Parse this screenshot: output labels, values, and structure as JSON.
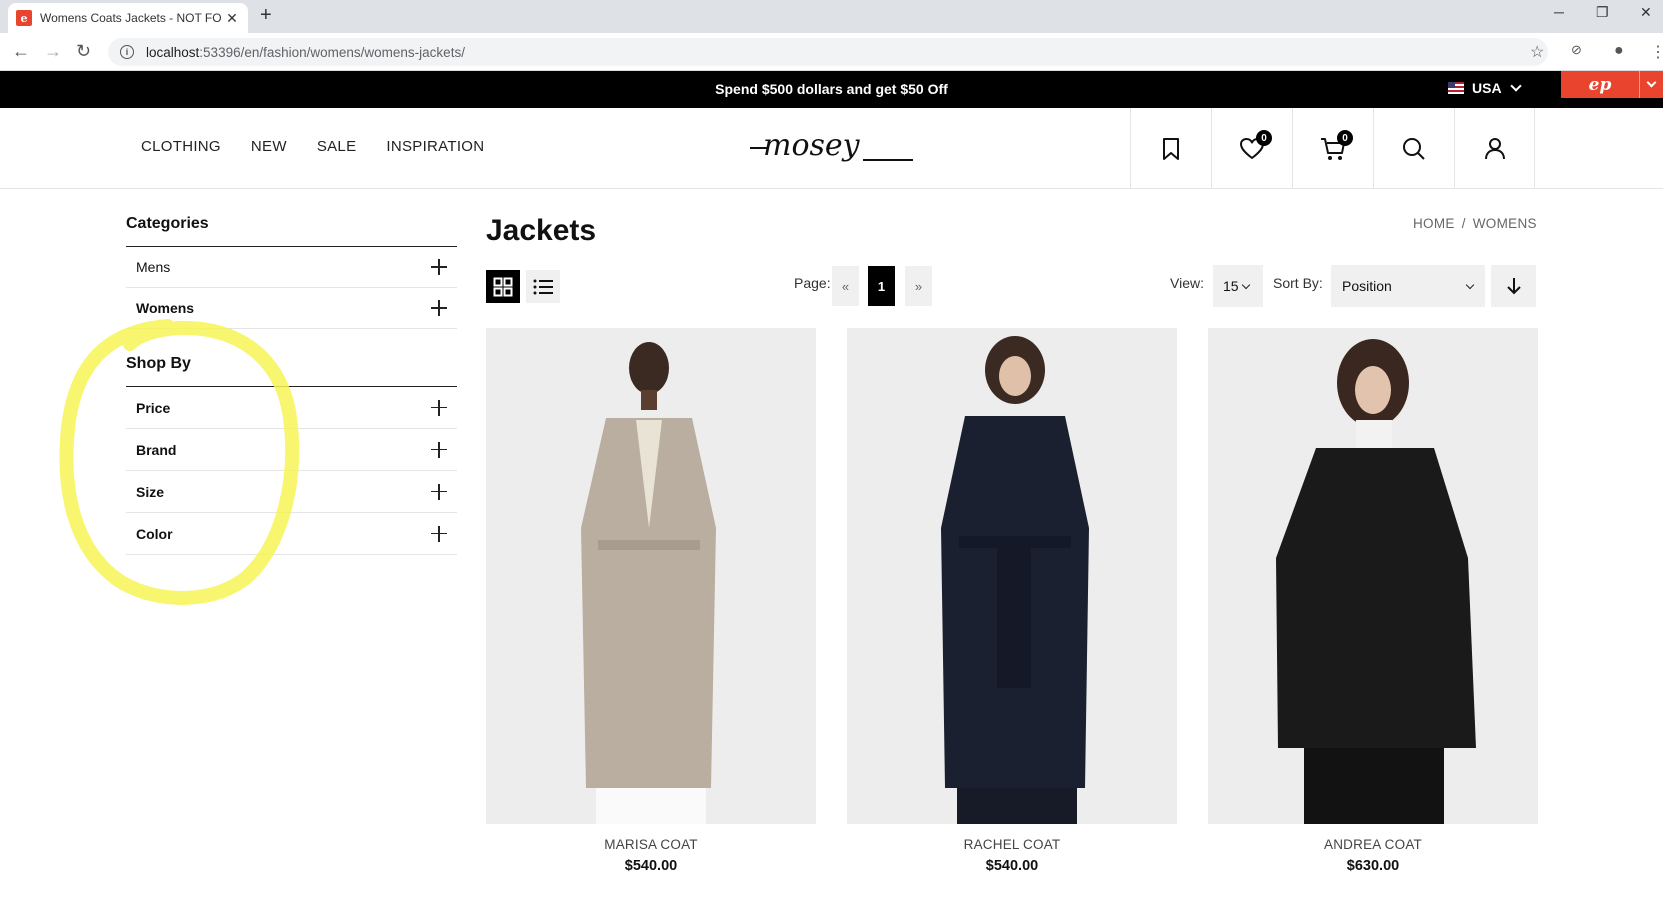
{
  "browser": {
    "tab_title": "Womens Coats Jackets - NOT FO",
    "url_host": "localhost",
    "url_path": ":53396/en/fashion/womens/womens-jackets/",
    "favicon_letter": "e"
  },
  "promo": {
    "text": "Spend $500 dollars and get $50 Off",
    "locale": "USA",
    "ep_logo": "ep"
  },
  "nav": {
    "items": [
      "CLOTHING",
      "NEW",
      "SALE",
      "INSPIRATION"
    ],
    "logo_text": "mosey"
  },
  "header_icons": {
    "wishlist_count": "0",
    "cart_count": "0"
  },
  "sidebar": {
    "categories_heading": "Categories",
    "categories": [
      "Mens",
      "Womens"
    ],
    "shopby_heading": "Shop By",
    "filters": [
      "Price",
      "Brand",
      "Size",
      "Color"
    ]
  },
  "page": {
    "title": "Jackets",
    "breadcrumb": [
      "HOME",
      "WOMENS"
    ],
    "breadcrumb_sep": "/"
  },
  "toolbar": {
    "page_label": "Page:",
    "prev": "«",
    "current_page": "1",
    "next": "»",
    "view_label": "View:",
    "view_value": "15",
    "sort_label": "Sort By:",
    "sort_value": "Position"
  },
  "products": [
    {
      "name": "MARISA COAT",
      "price": "$540.00",
      "coat_color": "#b9ae9f"
    },
    {
      "name": "RACHEL COAT",
      "price": "$540.00",
      "coat_color": "#1b2030"
    },
    {
      "name": "ANDREA COAT",
      "price": "$630.00",
      "coat_color": "#1a1a1a"
    }
  ],
  "colors": {
    "accent": "#e8442e",
    "highlight": "#f7f356"
  }
}
